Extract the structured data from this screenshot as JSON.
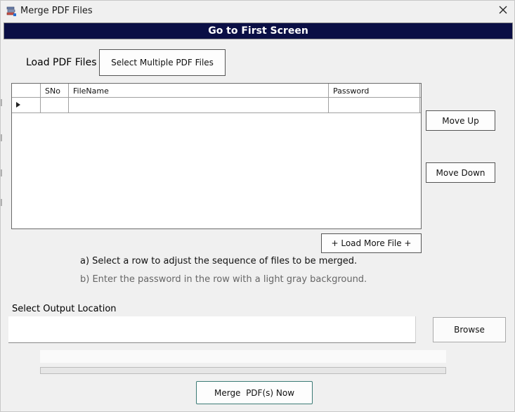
{
  "window": {
    "title": "Merge PDF Files",
    "icon": "pdf-stack-icon",
    "close_glyph": "✕"
  },
  "banner": {
    "label": "Go to First Screen"
  },
  "load": {
    "label": "Load PDF Files",
    "select_button": "Select Multiple PDF Files"
  },
  "grid": {
    "columns": [
      "SNo",
      "FileName",
      "Password"
    ],
    "rows": [
      {
        "sno": "",
        "filename": "",
        "password": ""
      }
    ],
    "row_indicator": "▶"
  },
  "side_buttons": {
    "move_up": "Move Up",
    "move_down": "Move Down"
  },
  "load_more": "+ Load More File +",
  "instructions": {
    "a": "a) Select a row to adjust the sequence of files to be merged.",
    "b": "b) Enter the password in the row with a light gray background."
  },
  "output": {
    "label": "Select Output Location",
    "value": "",
    "browse": "Browse"
  },
  "progress": {
    "fraction": 0
  },
  "merge_button": "Merge  PDF(s) Now",
  "colors": {
    "banner_bg": "#0b0f45",
    "banner_text": "#ffffff",
    "instruction_b": "#666666"
  }
}
